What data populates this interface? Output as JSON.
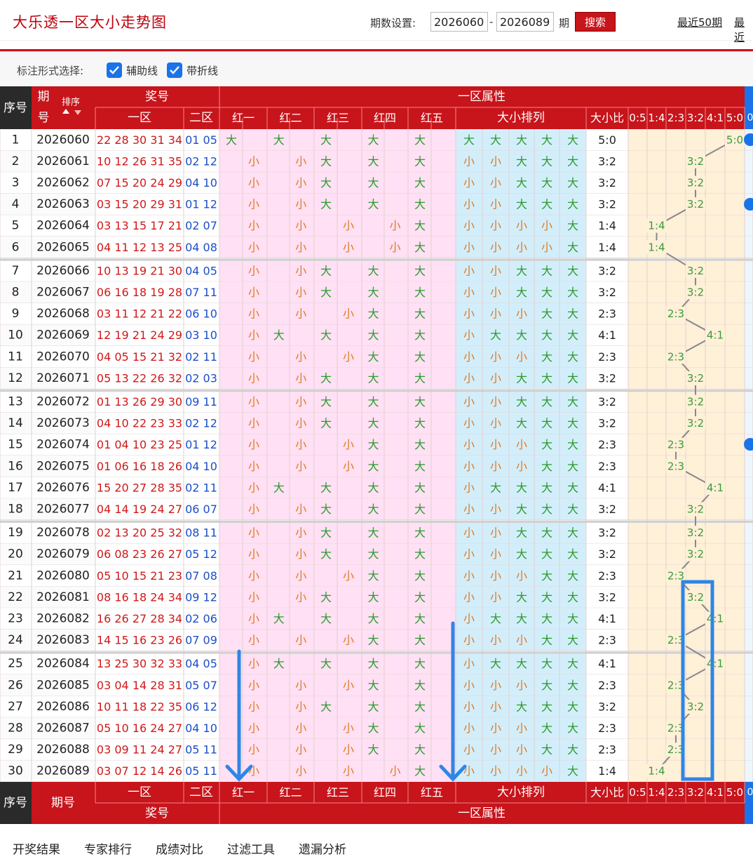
{
  "header": {
    "title": "大乐透一区大小走势图",
    "period_label": "期数设置:",
    "period_from": "2026060",
    "dash": "-",
    "period_to": "2026089",
    "period_unit": "期",
    "search_label": "搜索",
    "recent_50": "最近50期",
    "recent_more": "最近"
  },
  "marking": {
    "label": "标注形式选择:",
    "aux_line": "辅助线",
    "fold_line": "带折线"
  },
  "table": {
    "h_seq": "序号",
    "h_issue": "期号",
    "h_issue_a": "期",
    "h_issue_b": "号",
    "h_sort": "排序",
    "h_prize": "奖号",
    "h_attr": "一区属性",
    "h_zone1": "一区",
    "h_zone2": "二区",
    "h_reds": [
      "红一",
      "红二",
      "红三",
      "红四",
      "红五"
    ],
    "h_arrange": "大小排列",
    "h_ratio": "大小比",
    "h_ratios": [
      "0:5",
      "1:4",
      "2:3",
      "3:2",
      "4:1",
      "5:0"
    ],
    "h_extra": "0",
    "big": "大",
    "small": "小",
    "rows": [
      {
        "seq": "1",
        "issue": "2026060",
        "front": "22 28 30 31 34",
        "back": "01 05",
        "pat": "大大大大大",
        "ratio": "5:0"
      },
      {
        "seq": "2",
        "issue": "2026061",
        "front": "10 12 26 31 35",
        "back": "02 12",
        "pat": "小小大大大",
        "ratio": "3:2"
      },
      {
        "seq": "3",
        "issue": "2026062",
        "front": "07 15 20 24 29",
        "back": "04 10",
        "pat": "小小大大大",
        "ratio": "3:2"
      },
      {
        "seq": "4",
        "issue": "2026063",
        "front": "03 15 20 29 31",
        "back": "01 12",
        "pat": "小小大大大",
        "ratio": "3:2"
      },
      {
        "seq": "5",
        "issue": "2026064",
        "front": "03 13 15 17 21",
        "back": "02 07",
        "pat": "小小小小大",
        "ratio": "1:4"
      },
      {
        "seq": "6",
        "issue": "2026065",
        "front": "04 11 12 13 25",
        "back": "04 08",
        "pat": "小小小小大",
        "ratio": "1:4"
      },
      {
        "seq": "7",
        "issue": "2026066",
        "front": "10 13 19 21 30",
        "back": "04 05",
        "pat": "小小大大大",
        "ratio": "3:2"
      },
      {
        "seq": "8",
        "issue": "2026067",
        "front": "06 16 18 19 28",
        "back": "07 11",
        "pat": "小小大大大",
        "ratio": "3:2"
      },
      {
        "seq": "9",
        "issue": "2026068",
        "front": "03 11 12 21 22",
        "back": "06 10",
        "pat": "小小小大大",
        "ratio": "2:3"
      },
      {
        "seq": "10",
        "issue": "2026069",
        "front": "12 19 21 24 29",
        "back": "03 10",
        "pat": "小大大大大",
        "ratio": "4:1"
      },
      {
        "seq": "11",
        "issue": "2026070",
        "front": "04 05 15 21 32",
        "back": "02 11",
        "pat": "小小小大大",
        "ratio": "2:3"
      },
      {
        "seq": "12",
        "issue": "2026071",
        "front": "05 13 22 26 32",
        "back": "02 03",
        "pat": "小小大大大",
        "ratio": "3:2"
      },
      {
        "seq": "13",
        "issue": "2026072",
        "front": "01 13 26 29 30",
        "back": "09 11",
        "pat": "小小大大大",
        "ratio": "3:2"
      },
      {
        "seq": "14",
        "issue": "2026073",
        "front": "04 10 22 23 33",
        "back": "02 12",
        "pat": "小小大大大",
        "ratio": "3:2"
      },
      {
        "seq": "15",
        "issue": "2026074",
        "front": "01 04 10 23 25",
        "back": "01 12",
        "pat": "小小小大大",
        "ratio": "2:3"
      },
      {
        "seq": "16",
        "issue": "2026075",
        "front": "01 06 16 18 26",
        "back": "04 10",
        "pat": "小小小大大",
        "ratio": "2:3"
      },
      {
        "seq": "17",
        "issue": "2026076",
        "front": "15 20 27 28 35",
        "back": "02 11",
        "pat": "小大大大大",
        "ratio": "4:1"
      },
      {
        "seq": "18",
        "issue": "2026077",
        "front": "04 14 19 24 27",
        "back": "06 07",
        "pat": "小小大大大",
        "ratio": "3:2"
      },
      {
        "seq": "19",
        "issue": "2026078",
        "front": "02 13 20 25 32",
        "back": "08 11",
        "pat": "小小大大大",
        "ratio": "3:2"
      },
      {
        "seq": "20",
        "issue": "2026079",
        "front": "06 08 23 26 27",
        "back": "05 12",
        "pat": "小小大大大",
        "ratio": "3:2"
      },
      {
        "seq": "21",
        "issue": "2026080",
        "front": "05 10 15 21 23",
        "back": "07 08",
        "pat": "小小小大大",
        "ratio": "2:3"
      },
      {
        "seq": "22",
        "issue": "2026081",
        "front": "08 16 18 24 34",
        "back": "09 12",
        "pat": "小小大大大",
        "ratio": "3:2"
      },
      {
        "seq": "23",
        "issue": "2026082",
        "front": "16 26 27 28 34",
        "back": "02 06",
        "pat": "小大大大大",
        "ratio": "4:1"
      },
      {
        "seq": "24",
        "issue": "2026083",
        "front": "14 15 16 23 26",
        "back": "07 09",
        "pat": "小小小大大",
        "ratio": "2:3"
      },
      {
        "seq": "25",
        "issue": "2026084",
        "front": "13 25 30 32 33",
        "back": "04 05",
        "pat": "小大大大大",
        "ratio": "4:1"
      },
      {
        "seq": "26",
        "issue": "2026085",
        "front": "03 04 14 28 31",
        "back": "05 07",
        "pat": "小小小大大",
        "ratio": "2:3"
      },
      {
        "seq": "27",
        "issue": "2026086",
        "front": "10 11 18 22 35",
        "back": "06 12",
        "pat": "小小大大大",
        "ratio": "3:2"
      },
      {
        "seq": "28",
        "issue": "2026087",
        "front": "05 10 16 24 27",
        "back": "04 10",
        "pat": "小小小大大",
        "ratio": "2:3"
      },
      {
        "seq": "29",
        "issue": "2026088",
        "front": "03 09 11 24 27",
        "back": "05 11",
        "pat": "小小小大大",
        "ratio": "2:3"
      },
      {
        "seq": "30",
        "issue": "2026089",
        "front": "03 07 12 14 26",
        "back": "05 11",
        "pat": "小小小小大",
        "ratio": "1:4"
      }
    ]
  },
  "bottom_nav": [
    "开奖结果",
    "专家排行",
    "成绩对比",
    "过滤工具",
    "遗漏分析"
  ],
  "colors": {
    "brand": "#c8141b",
    "pink": "#ffe0f4",
    "blue": "#d3eefb",
    "cream": "#fff0d8",
    "annot": "#2e86e6",
    "big": "#2c9a2c",
    "small": "#e07a20"
  }
}
